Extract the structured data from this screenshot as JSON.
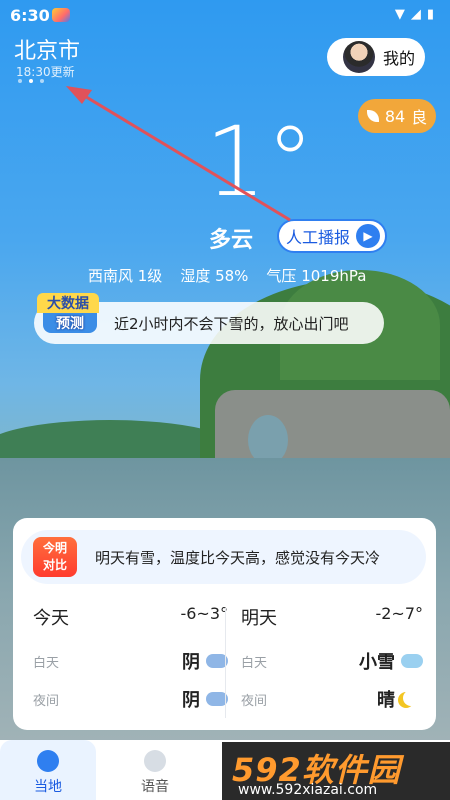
{
  "status": {
    "time": "6:30",
    "icons": [
      "wifi-icon",
      "signal-icon",
      "battery-icon"
    ]
  },
  "location": {
    "city": "北京市",
    "updated": "18:30更新"
  },
  "profile": {
    "label": "我的"
  },
  "aqi": {
    "value": "84",
    "level": "良"
  },
  "current": {
    "temp": "1°",
    "weather": "多云",
    "broadcast": "人工播报"
  },
  "metrics": {
    "wind": "西南风 1级",
    "humidity": "湿度 58%",
    "pressure": "气压 1019hPa"
  },
  "forecast": {
    "badge_line1": "大数据",
    "badge_line2": "预测",
    "text": "近2小时内不会下雪的，放心出门吧"
  },
  "compare": {
    "badge_line1": "今明",
    "badge_line2": "对比",
    "text": "明天有雪，温度比今天高，感觉没有今天冷"
  },
  "today": {
    "title": "今天",
    "range": "-6~3°",
    "day_label": "白天",
    "day_value": "阴",
    "night_label": "夜间",
    "night_value": "阴"
  },
  "tomorrow": {
    "title": "明天",
    "range": "-2~7°",
    "day_label": "白天",
    "day_value": "小雪",
    "night_label": "夜间",
    "night_value": "晴"
  },
  "nav": {
    "local": "当地",
    "voice": "语音"
  },
  "watermark": {
    "brand": "592软件园",
    "url": "www.592xiazai.com"
  },
  "colors": {
    "accent": "#2f7ff0",
    "aqi": "#f2a73a",
    "annotation": "#e0525a",
    "compare_badge": "#ff3b2e"
  }
}
